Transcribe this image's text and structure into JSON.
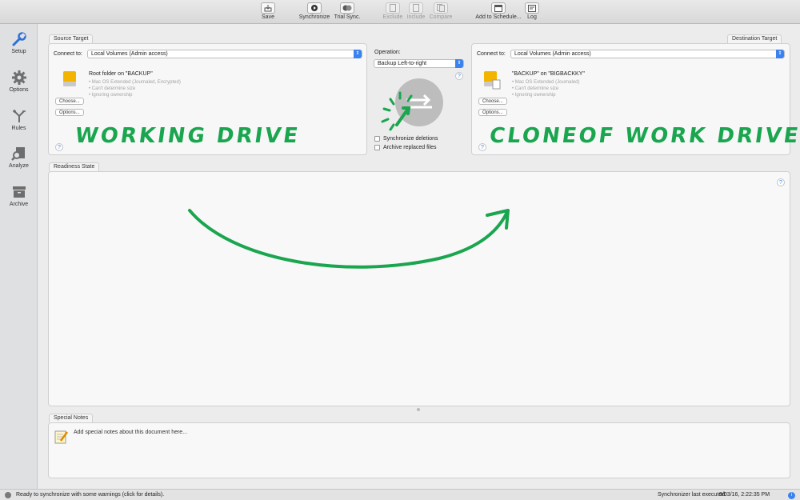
{
  "toolbar": {
    "save": "Save",
    "synchronize": "Synchronize",
    "trial_sync": "Trial Sync.",
    "exclude": "Exclude",
    "include": "Include",
    "compare": "Compare",
    "add_to_scheduler": "Add to Schedule...",
    "log": "Log"
  },
  "sidebar": {
    "items": [
      {
        "label": "Setup",
        "icon": "wrench-icon"
      },
      {
        "label": "Options",
        "icon": "gear-icon"
      },
      {
        "label": "Rules",
        "icon": "fork-icon"
      },
      {
        "label": "Analyze",
        "icon": "magnifier-document-icon"
      },
      {
        "label": "Archive",
        "icon": "archive-box-icon"
      }
    ]
  },
  "source": {
    "tab": "Source Target",
    "connect_label": "Connect to:",
    "connect_value": "Local Volumes (Admin access)",
    "title": "Root folder on \"BACKUP\"",
    "details": [
      "• Mac OS Extended (Journaled, Encrypted)",
      "• Can't determine size",
      "• Ignoring ownership"
    ],
    "choose": "Choose...",
    "options": "Options...",
    "annotation": "WORKING DRIVE"
  },
  "operation": {
    "label": "Operation:",
    "value": "Backup Left-to-right",
    "sync_deletions": "Synchronize deletions",
    "archive_replaced": "Archive replaced files"
  },
  "destination": {
    "tab": "Destination Target",
    "connect_label": "Connect to:",
    "connect_value": "Local Volumes (Admin access)",
    "title": "\"BACKUP\" on \"BIGBACKKY\"",
    "details": [
      "• Mac OS Extended (Journaled)",
      "• Can't determine size",
      "• Ignoring ownership"
    ],
    "choose": "Choose...",
    "options": "Options...",
    "annotation": "CLONEOF WORK DRIVE"
  },
  "readiness": {
    "tab": "Readiness State"
  },
  "notes": {
    "tab": "Special Notes",
    "text": "Add special notes about this document here..."
  },
  "status": {
    "message": "Ready to synchronize with some warnings (click for details).",
    "last_executed_label": "Synchronizer last executed:",
    "last_executed_value": "9/03/16, 2:22:35 PM"
  },
  "help_mark": "?",
  "colors": {
    "accent": "#3b82f0",
    "annotation": "#1aa54f",
    "drive": "#f2b400"
  }
}
